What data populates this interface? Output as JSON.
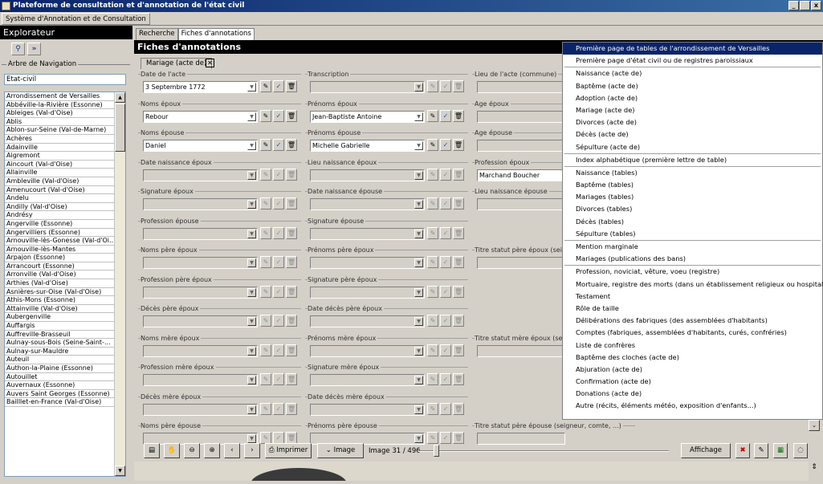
{
  "window": {
    "title": "Plateforme de consultation et d'annotation de l'état civil",
    "buttons": [
      "_",
      " ",
      "x"
    ]
  },
  "menubar": {
    "item": "Système d'Annotation et de Consultation"
  },
  "explorer": {
    "title": "Explorateur",
    "nav_label": "Arbre de Navigation",
    "root": "Etat-civil",
    "communes": [
      "Arrondissement de Versailles",
      "Abbéville-la-Rivière (Essonne)",
      "Ableiges (Val-d'Oise)",
      "Ablis",
      "Ablon-sur-Seine (Val-de-Marne)",
      "Achères",
      "Adainville",
      "Aigremont",
      "Aincourt (Val-d'Oise)",
      "Allainville",
      "Ambleville (Val-d'Oise)",
      "Amenucourt (Val-d'Oise)",
      "Andelu",
      "Andilly (Val-d'Oise)",
      "Andrésy",
      "Angerville (Essonne)",
      "Angervilliers (Essonne)",
      "Arnouville-lès-Gonesse (Val-d'Oi...",
      "Arnouville-lès-Mantes",
      "Arpajon (Essonne)",
      "Arrancourt (Essonne)",
      "Arronville (Val-d'Oise)",
      "Arthies (Val-d'Oise)",
      "Asnières-sur-Oise (Val-d'Oise)",
      "Athis-Mons (Essonne)",
      "Attainville (Val-d'Oise)",
      "Aubergenville",
      "Auffargis",
      "Auffreville-Brasseuil",
      "Aulnay-sous-Bois (Seine-Saint-...",
      "Aulnay-sur-Mauldre",
      "Auteuil",
      "Authon-la-Plaine (Essonne)",
      "Autouillet",
      "Auvernaux (Essonne)",
      "Auvers Saint Georges (Essonne)",
      "Bailllet-en-France (Val-d'Oise)"
    ]
  },
  "tabs": [
    "Recherche",
    "Fiches d'annotations"
  ],
  "fiche_title": "Fiches d'annotations",
  "acte_tab": "Mariage (acte de)",
  "fields": [
    {
      "label": "Date de l'acte",
      "value": "3 Septembre 1772"
    },
    {
      "label": "Transcription",
      "value": ""
    },
    {
      "label": "Lieu de l'acte (commune)",
      "value": ""
    },
    {
      "label": "Noms époux",
      "value": "Rebour"
    },
    {
      "label": "Prénoms époux",
      "value": "Jean-Baptiste Antoine"
    },
    {
      "label": "Age époux",
      "value": ""
    },
    {
      "label": "Noms épouse",
      "value": "Daniel"
    },
    {
      "label": "Prénoms épouse",
      "value": "Michelle Gabrielle"
    },
    {
      "label": "Age épouse",
      "value": ""
    },
    {
      "label": "Date naissance époux",
      "value": ""
    },
    {
      "label": "Lieu naissance époux",
      "value": ""
    },
    {
      "label": "Profession époux",
      "value": "Marchand Boucher"
    },
    {
      "label": "Signature époux",
      "value": ""
    },
    {
      "label": "Date naissance épouse",
      "value": ""
    },
    {
      "label": "Lieu naissance épouse",
      "value": ""
    },
    {
      "label": "Profession épouse",
      "value": ""
    },
    {
      "label": "Signature épouse",
      "value": ""
    },
    {
      "label": "Noms père époux",
      "value": ""
    },
    {
      "label": "Prénoms père époux",
      "value": ""
    },
    {
      "label": "Titre statut père époux (sei",
      "value": ""
    },
    {
      "label": "Profession père époux",
      "value": ""
    },
    {
      "label": "Signature père époux",
      "value": ""
    },
    {
      "label": "Décès père époux",
      "value": ""
    },
    {
      "label": "Date décès père époux",
      "value": ""
    },
    {
      "label": "Noms mère époux",
      "value": ""
    },
    {
      "label": "Prénoms mère époux",
      "value": ""
    },
    {
      "label": "Titre statut mère époux (sei",
      "value": ""
    },
    {
      "label": "Profession mère époux",
      "value": ""
    },
    {
      "label": "Signature mère époux",
      "value": ""
    },
    {
      "label": "Décès mère époux",
      "value": ""
    },
    {
      "label": "Date décès mère époux",
      "value": ""
    },
    {
      "label": "Noms père épouse",
      "value": ""
    },
    {
      "label": "Prénoms père épouse",
      "value": ""
    },
    {
      "label": "Titre statut père épouse (seigneur, comte, ...)",
      "value": ""
    }
  ],
  "menu": {
    "groups": [
      [
        "Première page de tables de l'arrondissement de Versailles",
        "Première page d'état civil ou de registres paroissiaux"
      ],
      [
        "Naissance (acte de)",
        "Baptême (acte de)",
        "Adoption (acte de)",
        "Mariage (acte de)",
        "Divorces (acte de)",
        "Décès (acte de)",
        "Sépulture (acte de)"
      ],
      [
        "Index alphabétique (première lettre de table)"
      ],
      [
        "Naissance (tables)",
        "Baptême (tables)",
        "Mariages (tables)",
        "Divorces (tables)",
        "Décès (tables)",
        "Sépulture (tables)"
      ],
      [
        "Mention marginale",
        "Mariages (publications des bans)"
      ],
      [
        "Profession, noviciat, vêture, voeu (registre)",
        "Mortuaire, registre des morts (dans un établissement religieux ou hospitalier)",
        "Testament",
        "Rôle de taille",
        "Délibérations des fabriques (des assemblées d'habitants)",
        "Comptes (fabriques, assemblées d'habitants, curés, confréries)",
        "Liste de confrères",
        "Baptême des cloches (acte de)",
        "Abjuration (acte de)",
        "Confirmation (acte de)",
        "Donations (acte de)",
        "Autre (récits, éléments météo, exposition d'enfants...)"
      ]
    ],
    "selected": "Première page de tables de l'arrondissement de Versailles"
  },
  "toolbar": {
    "print_label": "Imprimer",
    "image_label": "Image",
    "image_counter": "Image 31 / 496",
    "display_label": "Affichage"
  },
  "image_position": {
    "current": 31,
    "total": 496
  }
}
